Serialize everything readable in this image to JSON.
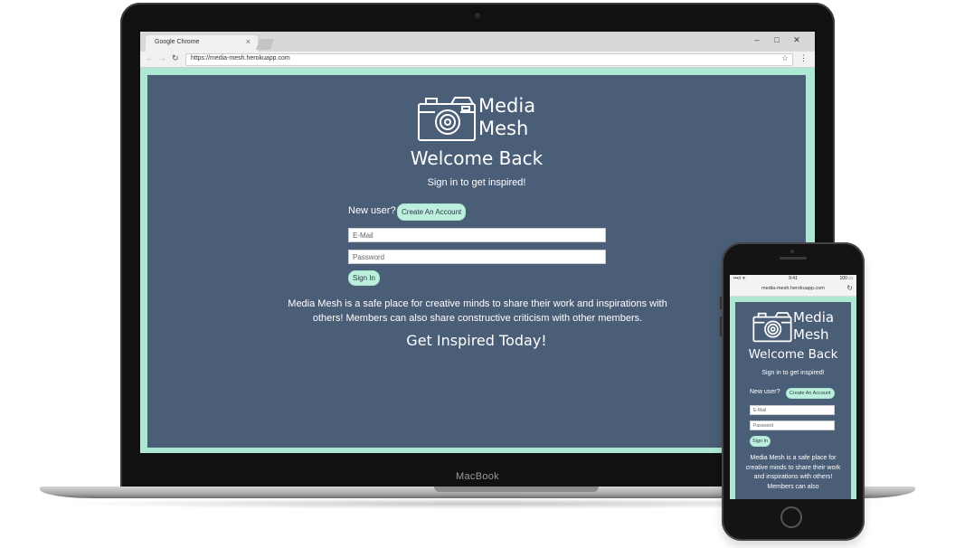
{
  "laptop": {
    "brand_label": "MacBook",
    "browser": {
      "tab_title": "Google Chrome",
      "tab_close_icon": "×",
      "window_controls": {
        "minimize": "–",
        "maximize": "□",
        "close": "✕"
      },
      "url": "https://media-mesh.herokuapp.com",
      "nav_icons": {
        "back": "←",
        "forward": "→",
        "reload": "↻",
        "star": "☆",
        "menu": "⋮"
      }
    }
  },
  "app": {
    "logo_line1": "Media",
    "logo_line2": "Mesh",
    "welcome": "Welcome Back",
    "subtitle": "Sign in to get inspired!",
    "new_user_label": "New user?",
    "create_account_label": "Create An Account",
    "email_placeholder": "E-Mail",
    "password_placeholder": "Password",
    "sign_in_label": "Sign In",
    "description": "Media Mesh is a safe place for creative minds to share their work and inspirations with others! Members can also share constructive criticism with other members.",
    "tagline": "Get Inspired Today!",
    "colors": {
      "page_bg": "#4b5e77",
      "frame_bg": "#aee8d2",
      "button_bg": "#bdf0dc"
    }
  },
  "phone": {
    "status": {
      "signal": "•••ıl ᯤ",
      "time": "9:41",
      "battery": "100 ▭"
    },
    "url": "media-mesh.herokuapp.com",
    "reload_icon": "↻",
    "description_visible": "Media Mesh is a safe place for creative minds to share their work and inspirations with others! Members can also"
  }
}
